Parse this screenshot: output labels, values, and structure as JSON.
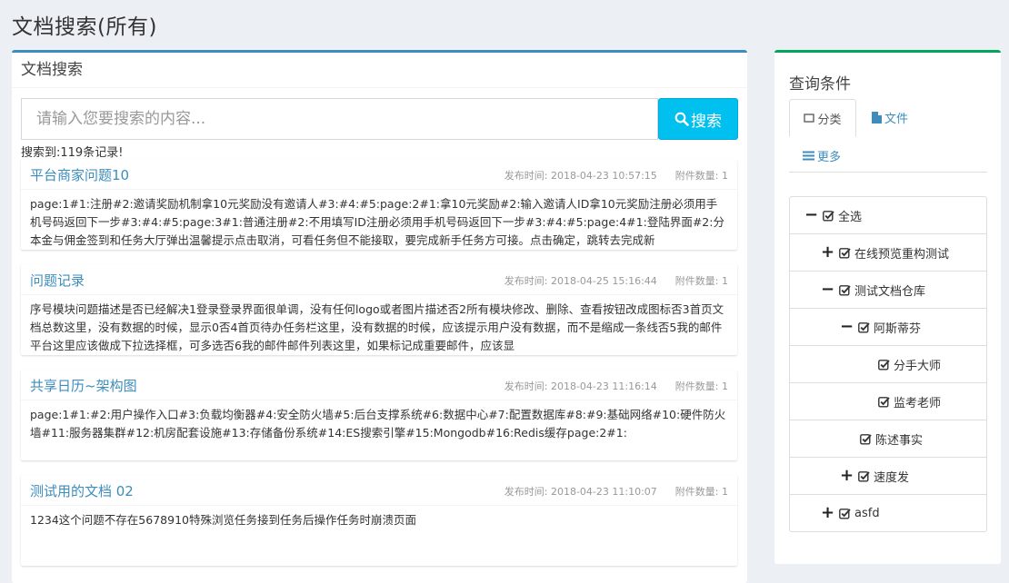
{
  "page": {
    "title": "文档搜索(所有)"
  },
  "search_box": {
    "header": "文档搜索",
    "placeholder": "请输入您要搜索的内容...",
    "button_label": "搜索",
    "result_count": "搜索到:119条记录!"
  },
  "results": [
    {
      "title": "平台商家问题10",
      "publish_time": "发布时间: 2018-04-23 10:57:15",
      "attachments": "附件数量: 1",
      "snippet": "page:1#1:注册#2:邀请奖励机制拿10元奖励没有邀请人#3:#4:#5:page:2#1:拿10元奖励#2:输入邀请人ID拿10元奖励注册必须用手机号码返回下一步#3:#4:#5:page:3#1:普通注册#2:不用填写ID注册必须用手机号码返回下一步#3:#4:#5:page:4#1:登陆界面#2:分本金与佣金签到和任务大厅弹出温馨提示点击取消，可看任务但不能接取，要完成新手任务方可接。点击确定，跳转去完成新"
    },
    {
      "title": "问题记录",
      "publish_time": "发布时间: 2018-04-25 15:16:44",
      "attachments": "附件数量: 1",
      "snippet": "序号模块问题描述是否已经解决1登录登录界面很单调，没有任何logo或者图片描述否2所有模块修改、删除、查看按钮改成图标否3首页文档总数这里，没有数据的时候，显示0否4首页待办任务栏这里，没有数据的时候，应该提示用户没有数据，而不是缩成一条线否5我的邮件平台这里应该做成下拉选择框，可多选否6我的邮件邮件列表这里，如果标记成重要邮件，应该显"
    },
    {
      "title": "共享日历~架构图",
      "publish_time": "发布时间: 2018-04-23 11:16:14",
      "attachments": "附件数量: 1",
      "snippet": "page:1#1:#2:用户操作入口#3:负载均衡器#4:安全防火墙#5:后台支撑系统#6:数据中心#7:配置数据库#8:#9:基础网络#10:硬件防火墙#11:服务器集群#12:机房配套设施#13:存储备份系统#14:ES搜索引擎#15:Mongodb#16:Redis缓存page:2#1:"
    },
    {
      "title": "测试用的文档 02",
      "publish_time": "发布时间: 2018-04-23 11:10:07",
      "attachments": "附件数量: 1",
      "snippet": "1234这个问题不存在5678910特殊浏览任务接到任务后操作任务时崩溃页面"
    }
  ],
  "filter": {
    "title": "查询条件",
    "tabs": [
      {
        "label": "分类",
        "icon": "tag-icon"
      },
      {
        "label": "文件",
        "icon": "file-icon"
      },
      {
        "label": "更多",
        "icon": "list-icon"
      }
    ],
    "tree": [
      {
        "label": "全选",
        "toggle": "−"
      },
      {
        "label": "在线预览重构测试",
        "toggle": "+"
      },
      {
        "label": "测试文档仓库",
        "toggle": "−"
      },
      {
        "label": "阿斯蒂芬",
        "toggle": "−"
      },
      {
        "label": "分手大师",
        "toggle": ""
      },
      {
        "label": "监考老师",
        "toggle": ""
      },
      {
        "label": "陈述事实",
        "toggle": ""
      },
      {
        "label": "速度发",
        "toggle": "+"
      },
      {
        "label": "asfd",
        "toggle": "+"
      }
    ]
  },
  "colors": {
    "primary": "#3c8dbc",
    "search_button": "#00c0ef",
    "filter_accent": "#00a65a",
    "background": "#ecf0f5"
  }
}
